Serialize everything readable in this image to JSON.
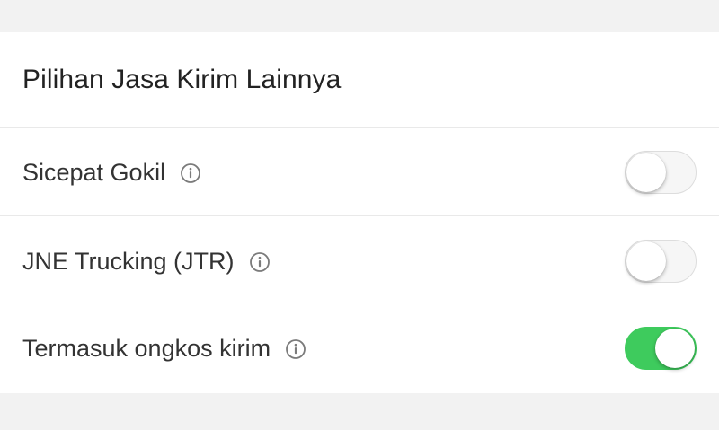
{
  "section": {
    "title": "Pilihan Jasa Kirim Lainnya"
  },
  "options": [
    {
      "label": "Sicepat Gokil",
      "info_icon": "info-circle-icon",
      "enabled": false
    },
    {
      "label": "JNE Trucking (JTR)",
      "info_icon": "info-circle-icon",
      "enabled": false
    },
    {
      "label": "Termasuk ongkos kirim",
      "info_icon": "info-circle-icon",
      "enabled": true
    }
  ],
  "colors": {
    "page_background": "#f2f2f2",
    "card_background": "#ffffff",
    "toggle_on": "#3ecb5d",
    "toggle_off": "#f6f6f6",
    "text": "#222222"
  }
}
